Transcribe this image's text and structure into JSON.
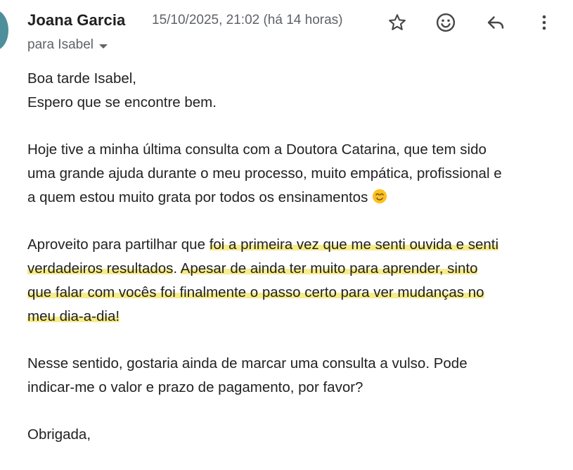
{
  "header": {
    "sender_name": "Joana Garcia",
    "timestamp": "15/10/2025, 21:02 (há 14 horas)",
    "recipient": "para Isabel"
  },
  "actions": {
    "star_icon": "star-icon",
    "emoji_icon": "emoji-reaction-icon",
    "reply_icon": "reply-icon",
    "more_icon": "more-options-icon"
  },
  "message": {
    "greeting_line1": "Boa tarde Isabel,",
    "greeting_line2": "Espero que se encontre bem.",
    "para1_line1": "Hoje tive a minha última consulta com a Doutora Catarina, que tem sido",
    "para1_line2": "uma grande ajuda durante o meu processo, muito empática, profissional e",
    "para1_line3": "a quem estou muito grata por todos os ensinamentos",
    "para1_emoji": "😊",
    "para2_line1_plain": "Aproveito para partilhar que ",
    "para2_line1_hl": "foi a primeira vez que me senti ouvida e senti",
    "para2_line2_hl_a": "verdadeiros resultados",
    "para2_line2_plain": ". ",
    "para2_line2_hl_b": "Apesar de ainda ter muito para aprender, sinto",
    "para2_line3_hl": "que falar com vocês foi finalmente o passo certo para ver mudanças no",
    "para2_line4_hl": "meu dia-a-dia!",
    "para3_line1": "Nesse sentido, gostaria ainda de marcar uma consulta a vulso. Pode",
    "para3_line2": "indicar-me o valor e prazo de pagamento, por favor?",
    "closing": "Obrigada,"
  },
  "colors": {
    "highlight": "#f7ec8a",
    "avatar": "#4d8f9a",
    "meta_text": "#5f6368"
  }
}
